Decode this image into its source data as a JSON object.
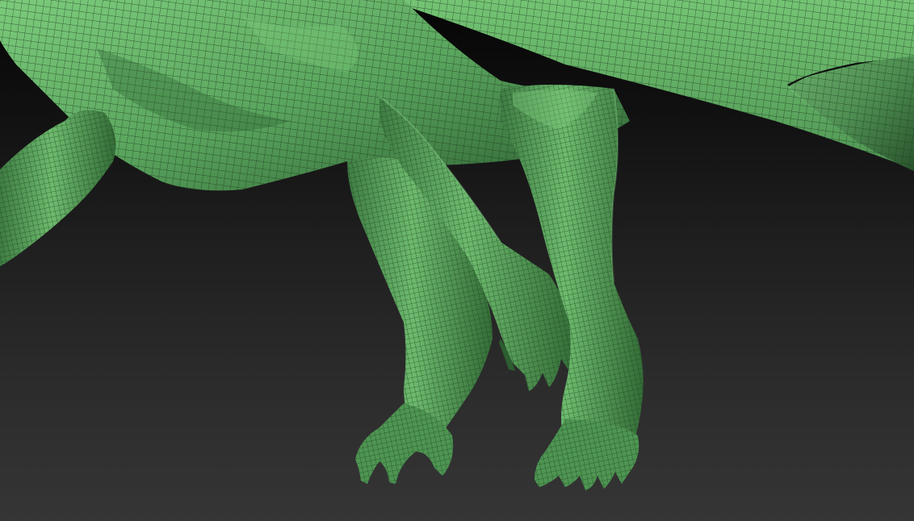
{
  "viewport": {
    "model_color": "#5aa55e",
    "model_highlight": "#7ccb7c",
    "model_shadow": "#2c5e30",
    "wire_color": "#1c3a1f",
    "background_top": "#050505",
    "background_bottom": "#353535"
  }
}
